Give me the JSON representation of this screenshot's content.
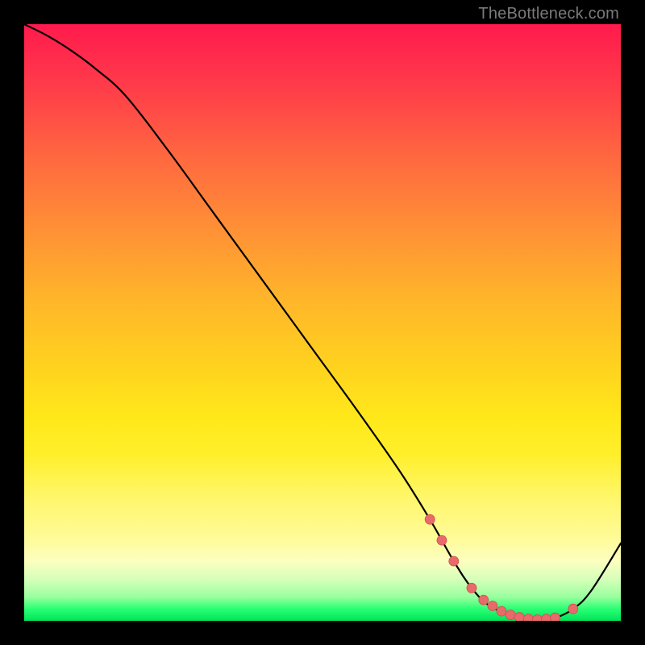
{
  "watermark": "TheBottleneck.com",
  "chart_data": {
    "type": "line",
    "title": "",
    "xlabel": "",
    "ylabel": "",
    "xlim": [
      0,
      100
    ],
    "ylim": [
      0,
      100
    ],
    "grid": false,
    "legend": false,
    "background_gradient": {
      "direction": "vertical",
      "stops": [
        {
          "pos": 0,
          "color": "#ff1a4d"
        },
        {
          "pos": 10,
          "color": "#ff3a4a"
        },
        {
          "pos": 22,
          "color": "#ff6740"
        },
        {
          "pos": 34,
          "color": "#ff8f36"
        },
        {
          "pos": 46,
          "color": "#ffb52a"
        },
        {
          "pos": 58,
          "color": "#ffd41e"
        },
        {
          "pos": 66,
          "color": "#ffe81a"
        },
        {
          "pos": 72,
          "color": "#ffef2a"
        },
        {
          "pos": 80,
          "color": "#fff770"
        },
        {
          "pos": 86,
          "color": "#fffb96"
        },
        {
          "pos": 90,
          "color": "#fcffbf"
        },
        {
          "pos": 93,
          "color": "#d6ffba"
        },
        {
          "pos": 96,
          "color": "#99ff9e"
        },
        {
          "pos": 98,
          "color": "#2aff74"
        },
        {
          "pos": 100,
          "color": "#00e358"
        }
      ]
    },
    "series": [
      {
        "name": "curve",
        "x": [
          0,
          4,
          8,
          12,
          17,
          24,
          32,
          40,
          48,
          56,
          63,
          68,
          72,
          75,
          78,
          82,
          86,
          89,
          92,
          95,
          100
        ],
        "y": [
          100,
          98,
          95.5,
          92.5,
          88,
          79,
          68,
          57,
          46,
          35,
          25,
          17,
          10,
          5.5,
          2.5,
          0.8,
          0.2,
          0.5,
          2,
          5,
          13
        ]
      }
    ],
    "markers": {
      "name": "highlight-points",
      "color": "#e86a6a",
      "x": [
        68,
        70,
        72,
        75,
        77,
        78.5,
        80,
        81.5,
        83,
        84.5,
        86,
        87.5,
        89,
        92
      ],
      "y": [
        17,
        13.5,
        10,
        5.5,
        3.5,
        2.5,
        1.6,
        1.0,
        0.6,
        0.3,
        0.2,
        0.3,
        0.5,
        2.0
      ]
    }
  }
}
